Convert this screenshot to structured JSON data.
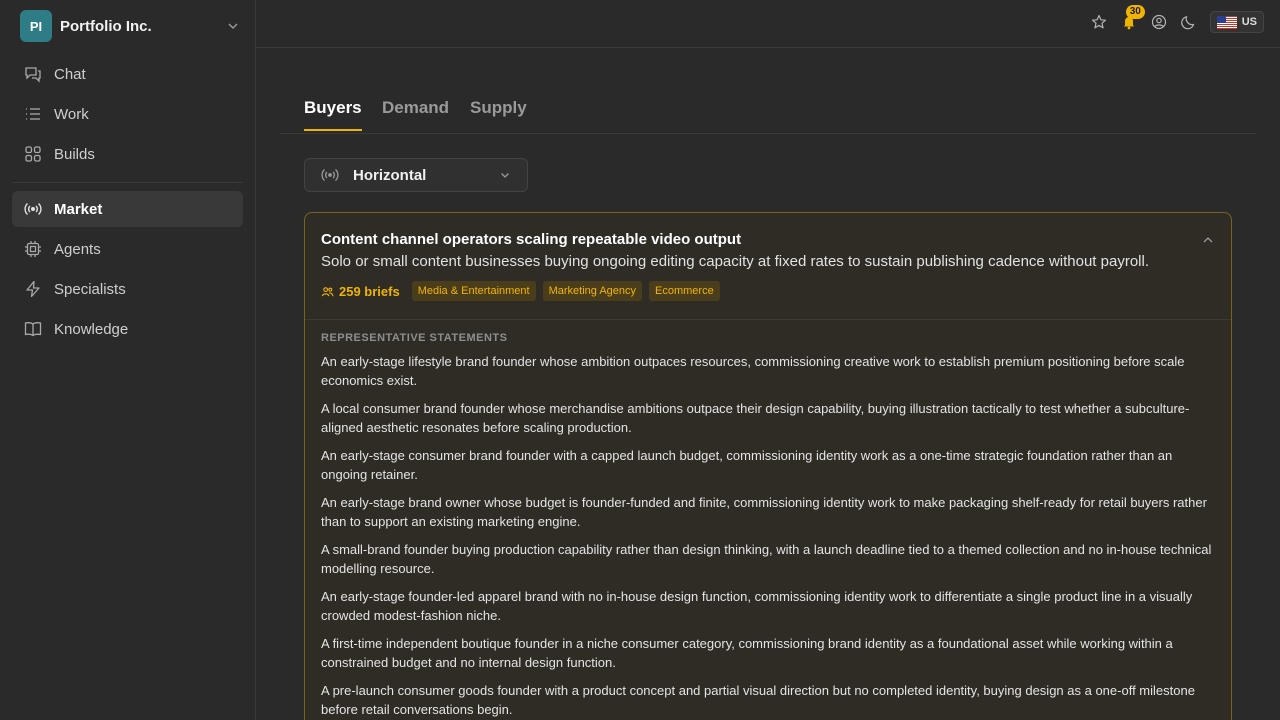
{
  "org": {
    "initials": "PI",
    "name": "Portfolio Inc."
  },
  "nav": [
    {
      "label": "Chat",
      "icon": "chat-icon"
    },
    {
      "label": "Work",
      "icon": "list-icon"
    },
    {
      "label": "Builds",
      "icon": "grid-icon"
    },
    {
      "label": "Market",
      "icon": "signal-icon",
      "active": true
    },
    {
      "label": "Agents",
      "icon": "chip-icon"
    },
    {
      "label": "Specialists",
      "icon": "bolt-icon"
    },
    {
      "label": "Knowledge",
      "icon": "book-icon"
    }
  ],
  "topbar": {
    "notifications": "30",
    "locale": "US"
  },
  "tabs": [
    "Buyers",
    "Demand",
    "Supply"
  ],
  "select": {
    "value": "Horizontal"
  },
  "card": {
    "title": "Content channel operators scaling repeatable video output",
    "subtitle": "Solo or small content businesses buying ongoing editing capacity at fixed rates to sustain publishing cadence without payroll.",
    "briefs": "259 briefs",
    "tags": [
      "Media & Entertainment",
      "Marketing Agency",
      "Ecommerce"
    ],
    "section_label": "REPRESENTATIVE STATEMENTS",
    "statements": [
      "An early-stage lifestyle brand founder whose ambition outpaces resources, commissioning creative work to establish premium positioning before scale economics exist.",
      "A local consumer brand founder whose merchandise ambitions outpace their design capability, buying illustration tactically to test whether a subculture-aligned aesthetic resonates before scaling production.",
      "An early-stage consumer brand founder with a capped launch budget, commissioning identity work as a one-time strategic foundation rather than an ongoing retainer.",
      "An early-stage brand owner whose budget is founder-funded and finite, commissioning identity work to make packaging shelf-ready for retail buyers rather than to support an existing marketing engine.",
      "A small-brand founder buying production capability rather than design thinking, with a launch deadline tied to a themed collection and no in-house technical modelling resource.",
      "An early-stage founder-led apparel brand with no in-house design function, commissioning identity work to differentiate a single product line in a visually crowded modest-fashion niche.",
      "A first-time independent boutique founder in a niche consumer category, commissioning brand identity as a foundational asset while working within a constrained budget and no internal design function.",
      "A pre-launch consumer goods founder with a product concept and partial visual direction but no completed identity, buying design as a one-off milestone before retail conversations begin."
    ]
  }
}
